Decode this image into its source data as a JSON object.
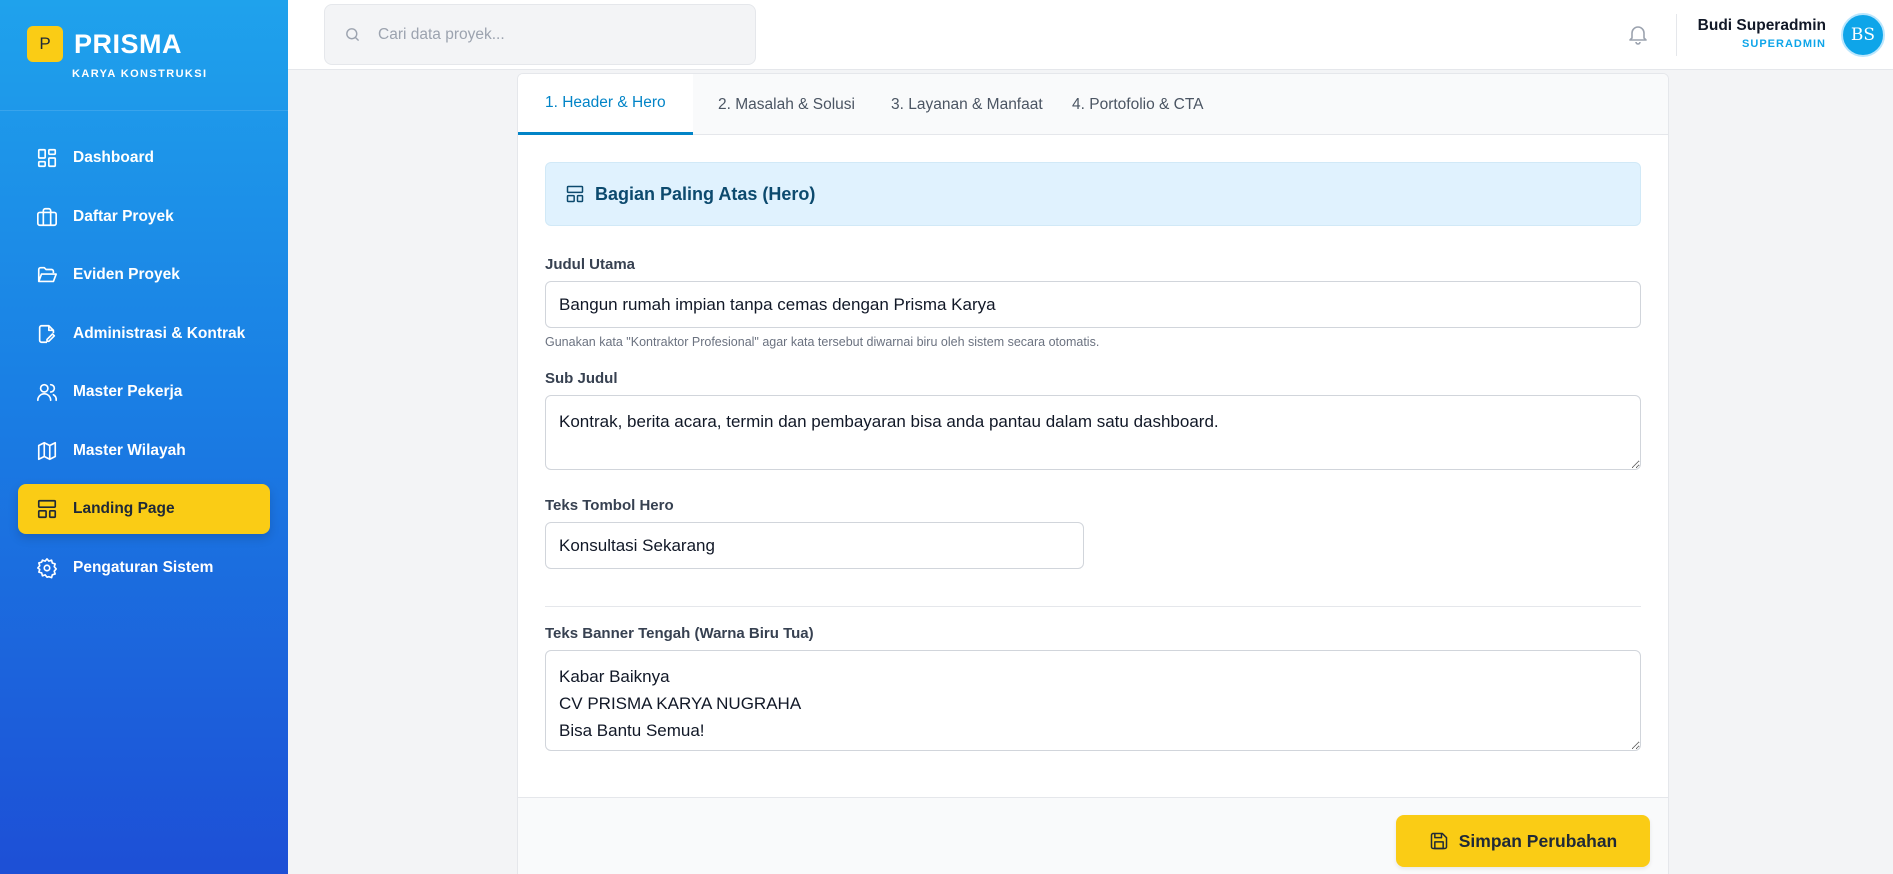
{
  "brand": {
    "logo_letter": "P",
    "name": "PRISMA",
    "subtitle": "KARYA KONSTRUKSI"
  },
  "sidebar": {
    "items": [
      {
        "label": "Dashboard",
        "icon": "dashboard-icon"
      },
      {
        "label": "Daftar Proyek",
        "icon": "briefcase-icon"
      },
      {
        "label": "Eviden Proyek",
        "icon": "folder-open-icon"
      },
      {
        "label": "Administrasi & Kontrak",
        "icon": "file-edit-icon"
      },
      {
        "label": "Master Pekerja",
        "icon": "users-icon"
      },
      {
        "label": "Master Wilayah",
        "icon": "map-icon"
      },
      {
        "label": "Landing Page",
        "icon": "layout-icon",
        "active": true
      },
      {
        "label": "Pengaturan Sistem",
        "icon": "gear-icon"
      }
    ]
  },
  "topbar": {
    "search_placeholder": "Cari data proyek...",
    "user_name": "Budi Superadmin",
    "user_role": "SUPERADMIN",
    "avatar_initials": "BS"
  },
  "tabs": [
    {
      "label": "1. Header & Hero",
      "active": true
    },
    {
      "label": "2. Masalah & Solusi"
    },
    {
      "label": "3. Layanan & Manfaat"
    },
    {
      "label": "4. Portofolio & CTA"
    }
  ],
  "section": {
    "title": "Bagian Paling Atas (Hero)",
    "judul_label": "Judul Utama",
    "judul_value": "Bangun rumah impian tanpa cemas dengan Prisma Karya",
    "judul_hint": "Gunakan kata \"Kontraktor Profesional\" agar kata tersebut diwarnai biru oleh sistem secara otomatis.",
    "subjudul_label": "Sub Judul",
    "subjudul_value": "Kontrak, berita acara, termin dan pembayaran bisa anda pantau dalam satu dashboard.",
    "tombol_label": "Teks Tombol Hero",
    "tombol_value": "Konsultasi Sekarang",
    "banner_label": "Teks Banner Tengah (Warna Biru Tua)",
    "banner_value": "Kabar Baiknya\nCV PRISMA KARYA NUGRAHA\nBisa Bantu Semua!"
  },
  "footer": {
    "save_label": "Simpan Perubahan"
  },
  "colors": {
    "accent_yellow": "#facc15",
    "accent_blue": "#0284c7",
    "sidebar_top": "#1fa2ec",
    "sidebar_bottom": "#1d4fd6"
  }
}
